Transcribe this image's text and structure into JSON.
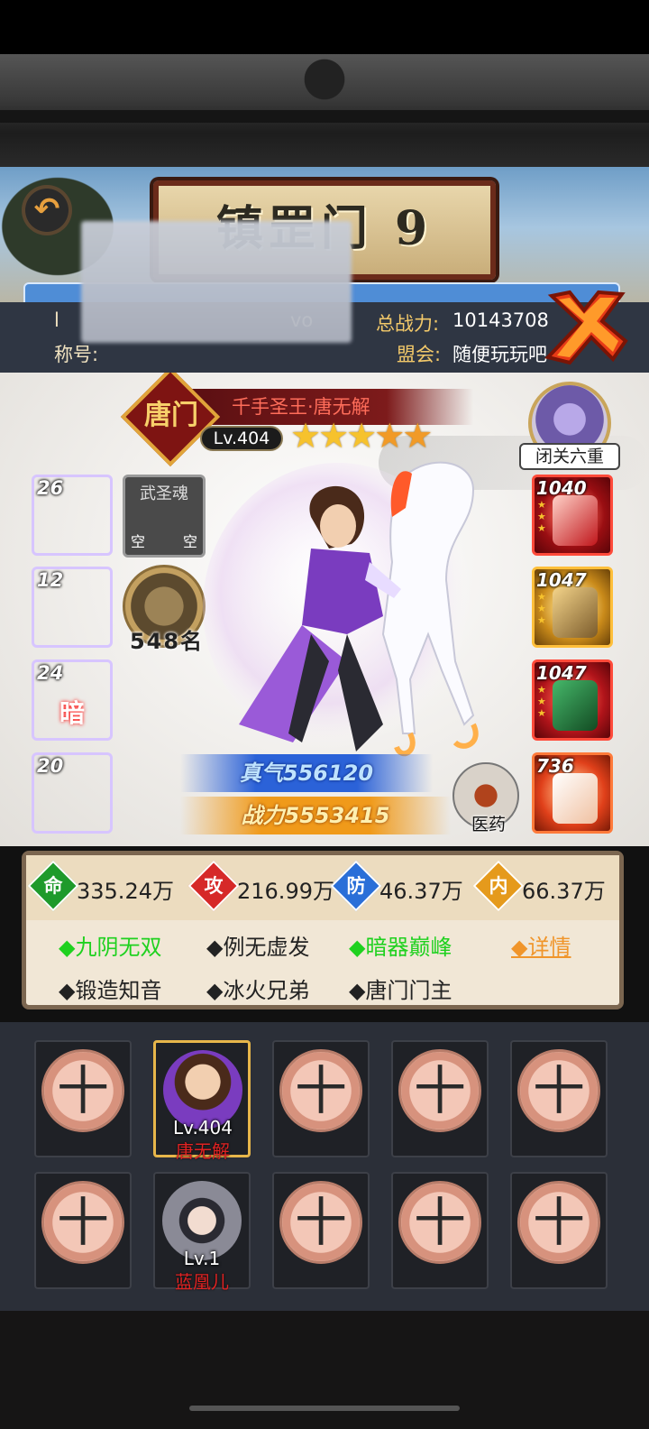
{
  "stage": {
    "title": "镇罡门 9"
  },
  "player": {
    "name_prefix": "l",
    "level_fragment": "vo",
    "title_label": "称号:",
    "power_label": "总战力:",
    "power_value": "10143708",
    "alliance_label": "盟会:",
    "alliance_value": "随便玩玩吧"
  },
  "hero": {
    "sect_badge": "唐门",
    "name": "千手圣王·唐无解",
    "level": "Lv.404",
    "stars_full": "★★★",
    "stars_partial": "★★",
    "retreat_label": "闭关六重",
    "soul_slot": {
      "title": "武圣魂",
      "left": "空",
      "right": "空"
    },
    "rank_text": "548名",
    "qi_text": "真气556120",
    "power_text": "战力5553415",
    "medicine_label": "医药"
  },
  "skills": [
    {
      "level": "26",
      "style": "purple",
      "glyph": ""
    },
    {
      "level": "12",
      "style": "red",
      "glyph": ""
    },
    {
      "level": "24",
      "style": "dark",
      "glyph": "暗"
    },
    {
      "level": "20",
      "style": "orb",
      "glyph": ""
    }
  ],
  "equipment": [
    {
      "level": "1040",
      "icon": "weapon-icon",
      "color": "#c0161b"
    },
    {
      "level": "1047",
      "icon": "tiger-armor-icon",
      "color": "#d8a21f"
    },
    {
      "level": "1047",
      "icon": "jade-book-icon",
      "color": "#1f7a3a"
    },
    {
      "level": "736",
      "icon": "horse-mount-icon",
      "color": "#e2492a"
    }
  ],
  "stats": [
    {
      "key": "命",
      "value": "335.24万",
      "color": "#1e9a2b"
    },
    {
      "key": "攻",
      "value": "216.99万",
      "color": "#d62828"
    },
    {
      "key": "防",
      "value": "46.37万",
      "color": "#2a6fd8"
    },
    {
      "key": "内",
      "value": "66.37万",
      "color": "#e59a1c"
    }
  ],
  "traits": [
    {
      "text": "◆九阴无双",
      "active": true
    },
    {
      "text": "◆例无虚发",
      "active": false
    },
    {
      "text": "◆暗器巅峰",
      "active": true
    },
    {
      "text": "◆锻造知音",
      "active": false
    },
    {
      "text": "◆冰火兄弟",
      "active": false
    },
    {
      "text": "◆唐门门主",
      "active": false
    }
  ],
  "details_link": "◆详情",
  "team": {
    "plus_glyph": "十",
    "members": [
      {
        "level": "Lv.404",
        "name": "唐无解"
      },
      {
        "level": "Lv.1",
        "name": "蓝凰儿"
      }
    ]
  }
}
